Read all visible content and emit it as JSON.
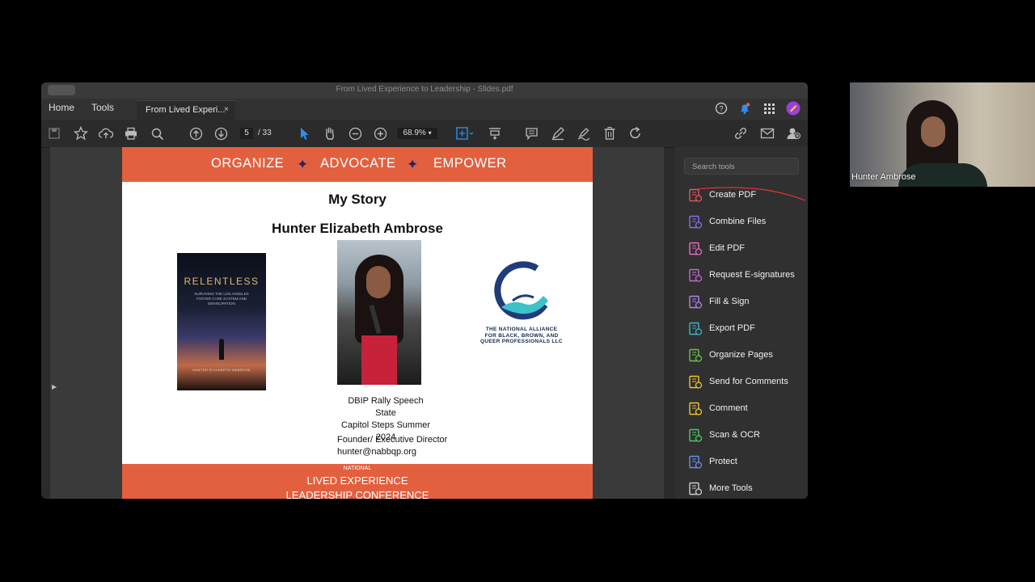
{
  "window": {
    "title": "From Lived Experience to Leadership - Slides.pdf",
    "nav": {
      "home": "Home",
      "tools": "Tools"
    },
    "tab": {
      "label": "From Lived Experi...",
      "close": "×"
    }
  },
  "toolbar": {
    "page_current": "5",
    "page_total": "/ 33",
    "zoom": "68.9%",
    "zoom_caret": "▾"
  },
  "slide": {
    "banner": {
      "word1": "ORGANIZE",
      "word2": "ADVOCATE",
      "word3": "EMPOWER",
      "star": "✦"
    },
    "title": "My Story",
    "name": "Hunter Elizabeth Ambrose",
    "book": {
      "title": "RELENTLESS",
      "subtitle": "SURVIVING THE LOS ANGELES FOSTER CARE SYSTEM AND EMANCIPATION",
      "author": "HUNTER ELIZABETH AMBROSE"
    },
    "caption": {
      "line1": "DBIP Rally Speech State",
      "line2": "Capitol Steps Summer",
      "line3": "2024"
    },
    "contact": {
      "role": "Founder/ Executive Director",
      "email": "hunter@nabbqp.org"
    },
    "logo_text": "THE NATIONAL ALLIANCE FOR BLACK, BROWN, AND QUEER PROFESSIONALS LLC",
    "footer": {
      "small": "NATIONAL",
      "line1": "LIVED EXPERIENCE",
      "line2": "LEADERSHIP CONFERENCE"
    }
  },
  "tools_pane": {
    "search_placeholder": "Search tools",
    "items": [
      {
        "label": "Create PDF",
        "color": "#e8545a"
      },
      {
        "label": "Combine Files",
        "color": "#8b6cf0"
      },
      {
        "label": "Edit PDF",
        "color": "#e76bc2"
      },
      {
        "label": "Request E-signatures",
        "color": "#c06ad6"
      },
      {
        "label": "Fill & Sign",
        "color": "#b083f0"
      },
      {
        "label": "Export PDF",
        "color": "#39b8c8"
      },
      {
        "label": "Organize Pages",
        "color": "#6cc24a"
      },
      {
        "label": "Send for Comments",
        "color": "#f0c52e"
      },
      {
        "label": "Comment",
        "color": "#f0c52e"
      },
      {
        "label": "Scan & OCR",
        "color": "#4fc76a"
      },
      {
        "label": "Protect",
        "color": "#6c8df0"
      },
      {
        "label": "More Tools",
        "color": "#cccccc"
      }
    ]
  },
  "video": {
    "participant_name": "Hunter Ambrose"
  }
}
